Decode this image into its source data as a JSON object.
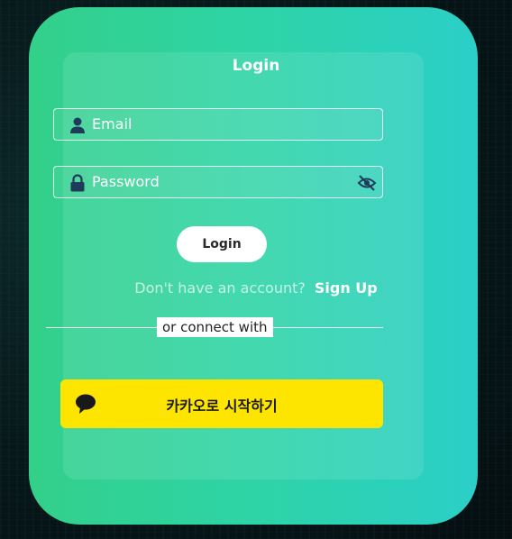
{
  "card": {
    "title": "Login",
    "email_placeholder": "Email",
    "password_placeholder": "Password",
    "login_button": "Login",
    "signup_prompt": "Don't have an account?",
    "signup_link": "Sign Up",
    "divider_text": "or connect with",
    "kakao_button": "카카오로 시작하기"
  },
  "icons": {
    "email": "user-icon",
    "password": "lock-icon",
    "visibility": "eye-off-icon",
    "kakao": "speech-bubble-icon"
  },
  "colors": {
    "kakao_yellow": "#FEE500",
    "icon_navy": "#1f3b5a",
    "card_gradient_start": "#33d08a",
    "card_gradient_end": "#2bcfc8"
  }
}
